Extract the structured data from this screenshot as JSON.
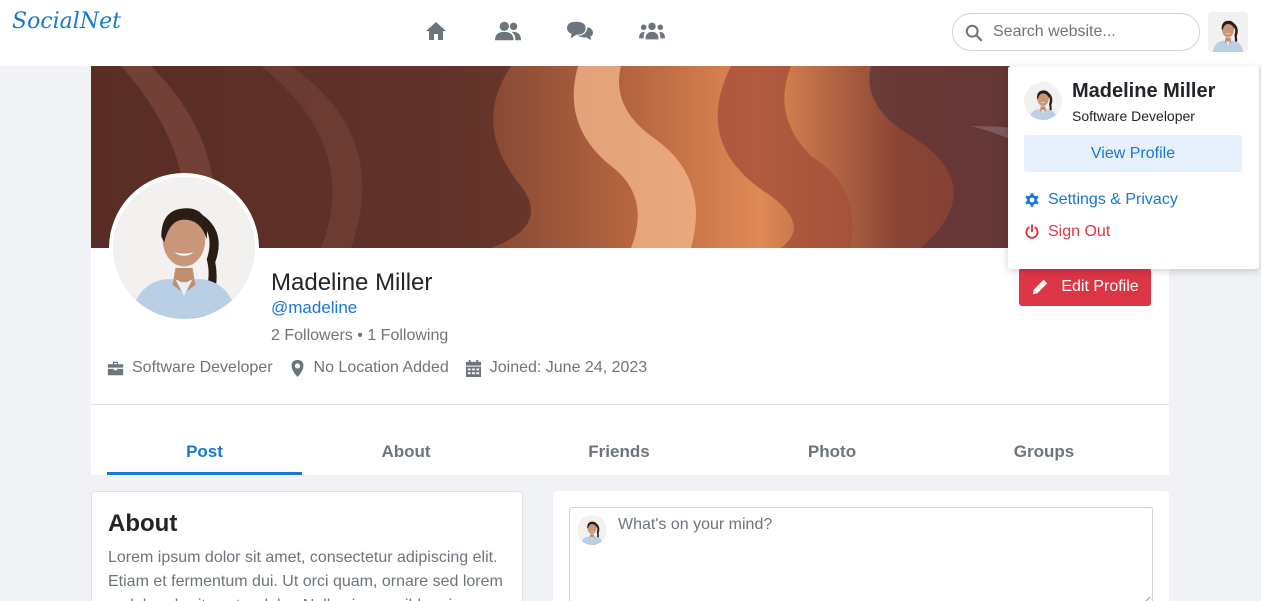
{
  "colors": {
    "accent": "#1877d2",
    "danger": "#dc3545",
    "muted": "#6c757d",
    "page_bg": "#f0f2f5"
  },
  "navbar": {
    "brand": "SocialNet",
    "icons": [
      "home-icon",
      "friends-icon",
      "messages-icon",
      "groups-icon"
    ],
    "search": {
      "placeholder": "Search website...",
      "value": ""
    }
  },
  "profile": {
    "name": "Madeline Miller",
    "handle": "@madeline",
    "followers": "2 Followers",
    "separator": "•",
    "following": "1 Following",
    "occupation": "Software Developer",
    "location": "No Location Added",
    "joined": "Joined: June 24, 2023",
    "edit_label": "Edit Profile"
  },
  "tabs": [
    {
      "label": "Post",
      "active": true
    },
    {
      "label": "About",
      "active": false
    },
    {
      "label": "Friends",
      "active": false
    },
    {
      "label": "Photo",
      "active": false
    },
    {
      "label": "Groups",
      "active": false
    }
  ],
  "about": {
    "title": "About",
    "text": "Lorem ipsum dolor sit amet, consectetur adipiscing elit. Etiam et fermentum dui. Ut orci quam, ornare sed lorem sed, hendrerit auctor dolor. Nulla viverra nibh quis"
  },
  "composer": {
    "placeholder": "What's on your mind?"
  },
  "dropdown": {
    "name": "Madeline Miller",
    "role": "Software Developer",
    "view_profile": "View Profile",
    "settings": "Settings & Privacy",
    "sign_out": "Sign Out"
  }
}
